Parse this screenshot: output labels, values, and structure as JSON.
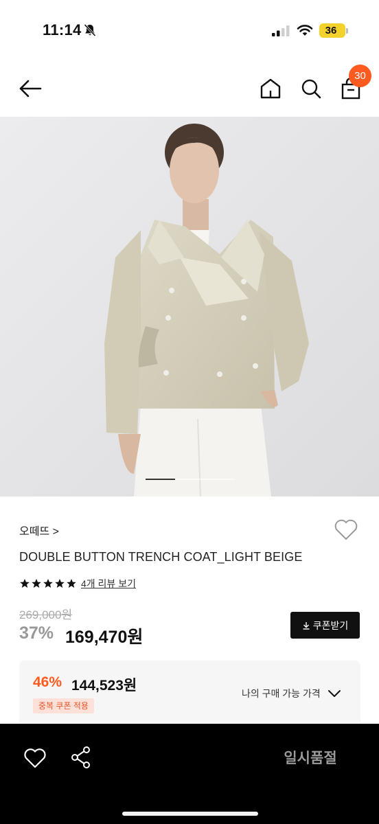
{
  "status_bar": {
    "time": "11:14",
    "battery": "36",
    "icons": [
      "bell-slash-icon",
      "signal-icon",
      "wifi-icon",
      "battery-icon"
    ]
  },
  "header": {
    "cart_count": "30",
    "icons": [
      "arrow-left-icon",
      "home-icon",
      "search-icon",
      "shopping-bag-icon"
    ],
    "badge_color": "#ff5a1f"
  },
  "carousel": {
    "current_slide": 1,
    "indicator_fill": 0.33
  },
  "product": {
    "brand": "오떼뜨 >",
    "name": "DOUBLE BUTTON TRENCH COAT_LIGHT BEIGE",
    "rating": 5,
    "review_link": "4개 리뷰 보기",
    "original_price": "269,000원",
    "discount_rate": "37%",
    "sale_price": "169,470원",
    "coupon_button": "쿠폰받기"
  },
  "benefit": {
    "rate": "46%",
    "price": "144,523원",
    "tag": "중복 쿠폰 적용",
    "toggle_label": "나의 구매 가능 가격",
    "accent_color": "#ff5a1f"
  },
  "bottom_bar": {
    "soldout_label": "일시품절",
    "icons": [
      "heart-icon",
      "share-icon"
    ]
  }
}
